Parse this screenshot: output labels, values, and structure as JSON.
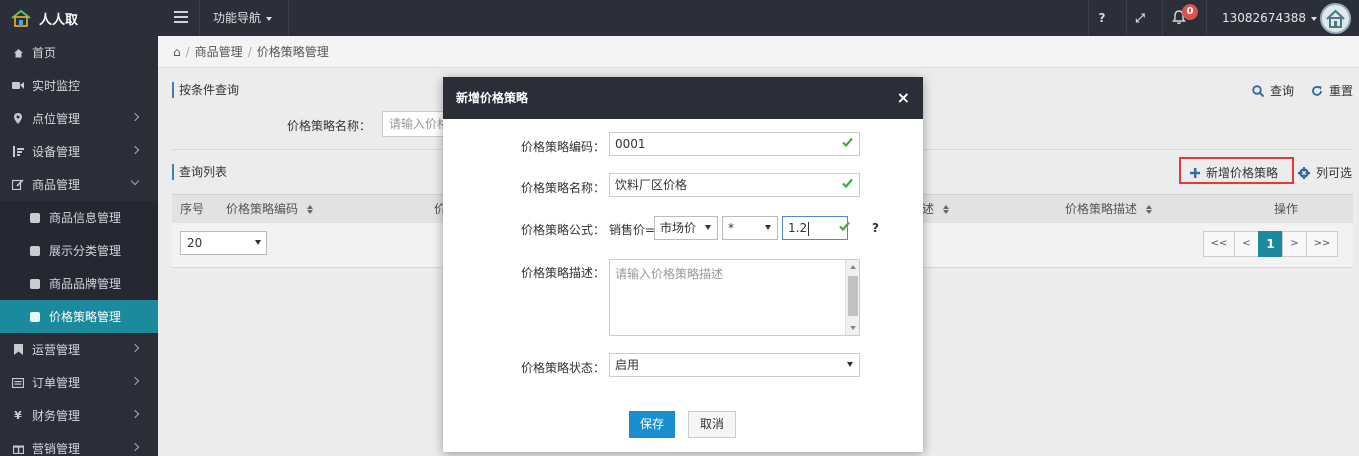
{
  "brand": {
    "name": "人人取"
  },
  "topbar": {
    "func_nav": "功能导航",
    "help": "?",
    "fullscreen": "⤢",
    "notifications_count": "0",
    "user_phone": "13082674388"
  },
  "sidebar": {
    "items": [
      {
        "label": "首页"
      },
      {
        "label": "实时监控"
      },
      {
        "label": "点位管理"
      },
      {
        "label": "设备管理"
      },
      {
        "label": "商品管理"
      },
      {
        "label": "商品信息管理"
      },
      {
        "label": "展示分类管理"
      },
      {
        "label": "商品品牌管理"
      },
      {
        "label": "价格策略管理"
      },
      {
        "label": "运营管理"
      },
      {
        "label": "订单管理"
      },
      {
        "label": "财务管理"
      },
      {
        "label": "营销管理"
      }
    ]
  },
  "breadcrumb": {
    "home": "⌂",
    "level1": "商品管理",
    "level2": "价格策略管理"
  },
  "search_section": {
    "title": "按条件查询",
    "name_label": "价格策略名称：",
    "name_placeholder": "请输入价格",
    "query": "查询",
    "reset": "重置"
  },
  "list_section": {
    "title": "查询列表",
    "add_button": "新增价格策略",
    "columns_button": "列可选",
    "columns": {
      "index": "序号",
      "code": "价格策略编码",
      "c3": "价",
      "c4": "述",
      "desc": "价格策略描述",
      "action": "操作"
    },
    "page_size": "20",
    "pager": {
      "first": "<<",
      "prev": "<",
      "current": "1",
      "next": ">",
      "last": ">>"
    }
  },
  "modal": {
    "title": "新增价格策略",
    "close": "×",
    "code_label": "价格策略编码：",
    "code_value": "0001",
    "name_label": "价格策略名称：",
    "name_value": "饮料厂区价格",
    "formula_label": "价格策略公式：",
    "formula_prefix": "销售价=",
    "formula_base": "市场价",
    "formula_operator": "*",
    "formula_factor": "1.2",
    "formula_help": "?",
    "desc_label": "价格策略描述：",
    "desc_placeholder": "请输入价格策略描述",
    "status_label": "价格策略状态：",
    "status_value": "启用",
    "save": "保存",
    "cancel": "取消"
  },
  "colors": {
    "topbar_bg": "#2b2f3a",
    "sidebar_bg": "#2a2e39",
    "active_item": "#1a8a9c",
    "primary_button": "#1a8fd0",
    "highlight_box": "#e53935",
    "check_green": "#3cae3c"
  }
}
